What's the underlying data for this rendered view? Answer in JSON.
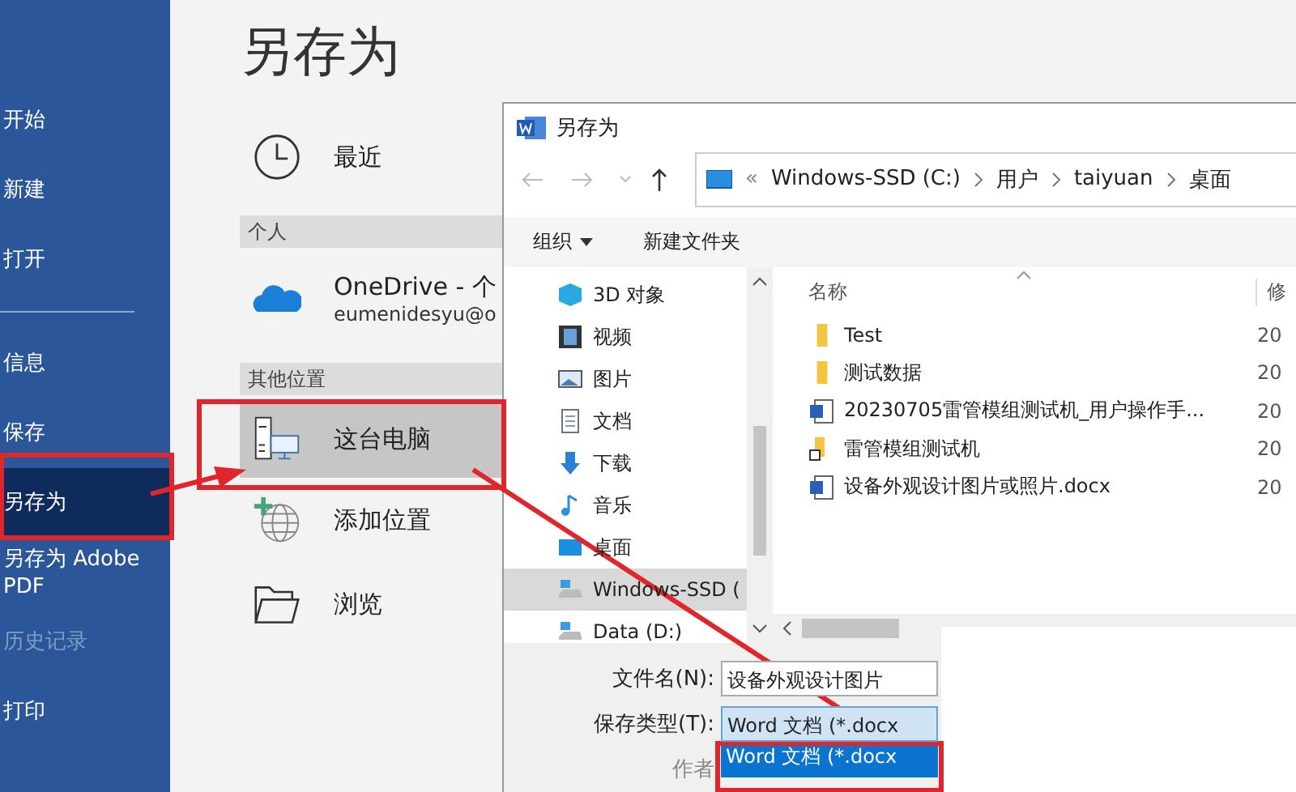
{
  "sidebar": {
    "items": [
      {
        "kind": "item",
        "label": "开始",
        "selected": false,
        "disabled": false
      },
      {
        "kind": "item",
        "label": "新建",
        "selected": false,
        "disabled": false
      },
      {
        "kind": "item",
        "label": "打开",
        "selected": false,
        "disabled": false
      },
      {
        "kind": "divider"
      },
      {
        "kind": "item",
        "label": "信息",
        "selected": false,
        "disabled": false
      },
      {
        "kind": "item",
        "label": "保存",
        "selected": false,
        "disabled": false
      },
      {
        "kind": "item",
        "label": "另存为",
        "selected": true,
        "disabled": false
      },
      {
        "kind": "item",
        "label": "另存为 Adobe PDF",
        "selected": false,
        "disabled": false
      },
      {
        "kind": "item",
        "label": "历史记录",
        "selected": false,
        "disabled": true
      },
      {
        "kind": "item",
        "label": "打印",
        "selected": false,
        "disabled": false
      }
    ]
  },
  "page_title": "另存为",
  "locations": [
    {
      "kind": "clock",
      "label": "最近",
      "selected": false
    },
    {
      "kind": "header",
      "label": "个人"
    },
    {
      "kind": "cloud",
      "label": "OneDrive - 个",
      "sublabel": "eumenidesyu@o",
      "selected": false
    },
    {
      "kind": "header",
      "label": "其他位置"
    },
    {
      "kind": "computer",
      "label": "这台电脑",
      "selected": true
    },
    {
      "kind": "globe",
      "label": "添加位置",
      "selected": false
    },
    {
      "kind": "folder",
      "label": "浏览",
      "selected": false
    }
  ],
  "dialog": {
    "title": "另存为",
    "address": {
      "overflow": "«",
      "path": [
        "Windows-SSD (C:)",
        "用户",
        "taiyuan",
        "桌面"
      ]
    },
    "toolbar": {
      "organize": "组织",
      "new_folder": "新建文件夹"
    },
    "nav": [
      {
        "kind": "cube",
        "label": "3D 对象",
        "selected": false
      },
      {
        "kind": "film",
        "label": "视频",
        "selected": false
      },
      {
        "kind": "picture",
        "label": "图片",
        "selected": false
      },
      {
        "kind": "document",
        "label": "文档",
        "selected": false
      },
      {
        "kind": "download",
        "label": "下载",
        "selected": false
      },
      {
        "kind": "music",
        "label": "音乐",
        "selected": false
      },
      {
        "kind": "desktop",
        "label": "桌面",
        "selected": false
      },
      {
        "kind": "drive",
        "label": "Windows-SSD (",
        "selected": true
      },
      {
        "kind": "drive",
        "label": "Data (D:)",
        "selected": false
      }
    ],
    "columns": [
      "名称",
      "修"
    ],
    "files": [
      {
        "kind": "folder",
        "name": "Test",
        "date": "20"
      },
      {
        "kind": "folder",
        "name": "测试数据",
        "date": "20"
      },
      {
        "kind": "word",
        "name": "20230705雷管模组测试机_用户操作手...",
        "date": "20"
      },
      {
        "kind": "shortcut",
        "name": "雷管模组测试机",
        "date": "20"
      },
      {
        "kind": "word",
        "name": "设备外观设计图片或照片.docx",
        "date": "20"
      }
    ],
    "form": {
      "filename_label": "文件名(N):",
      "filename": "设备外观设计图片",
      "type_label": "保存类型(T):",
      "type": "Word 文档 (*.docx",
      "option": "Word 文档 (*.docx",
      "author_label": "作者"
    }
  }
}
